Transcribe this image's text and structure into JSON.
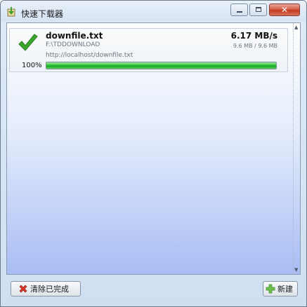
{
  "window": {
    "title": "快速下载器",
    "icon": "app-download-icon",
    "close_glyph": "✕"
  },
  "downloads": [
    {
      "filename": "downfile.txt",
      "speed": "6.17 MB/s",
      "path": "F:\\TDDOWNLOAD",
      "size": "9.6 MB  /  9.6 MB",
      "url": "http://localhost/downfile.txt",
      "percent_label": "100%",
      "progress": 1.0,
      "status_icon": "check-icon"
    }
  ],
  "buttons": {
    "clear_label": "清除已完成",
    "new_label": "新建"
  },
  "scrollbar": {
    "up_glyph": "▲",
    "down_glyph": "▼"
  },
  "colors": {
    "progress_green": "#1fb22a",
    "check_green": "#3aa62b",
    "close_red": "#c43a20"
  }
}
